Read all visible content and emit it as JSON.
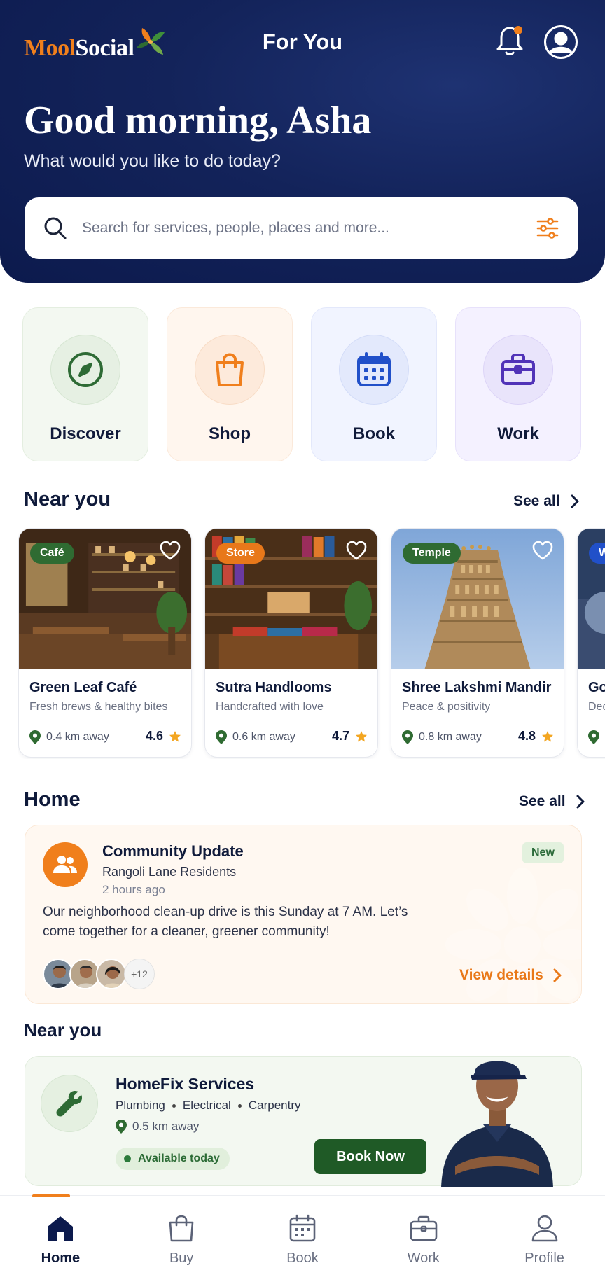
{
  "header": {
    "logo_part1": "Mool",
    "logo_part2": "Social",
    "title": "For You",
    "greeting": "Good morning, Asha",
    "subtitle": "What would you like to do today?"
  },
  "search": {
    "placeholder": "Search for services, people, places and more..."
  },
  "categories": [
    {
      "label": "Discover",
      "icon": "compass-icon",
      "color": "#2e6b35"
    },
    {
      "label": "Shop",
      "icon": "shopping-bag-icon",
      "color": "#f07f1c"
    },
    {
      "label": "Book",
      "icon": "calendar-icon",
      "color": "#2150c9"
    },
    {
      "label": "Work",
      "icon": "briefcase-icon",
      "color": "#5133b8"
    }
  ],
  "near_you": {
    "heading": "Near you",
    "see_all": "See all",
    "places": [
      {
        "badge": "Café",
        "badge_color": "#2f6b32",
        "name": "Green Leaf Café",
        "desc": "Fresh brews & healthy bites",
        "distance": "0.4 km away",
        "rating": "4.6"
      },
      {
        "badge": "Store",
        "badge_color": "#e8781a",
        "name": "Sutra Handlooms",
        "desc": "Handcrafted with love",
        "distance": "0.6 km away",
        "rating": "4.7"
      },
      {
        "badge": "Temple",
        "badge_color": "#2f6b32",
        "name": "Shree Lakshmi Mandir",
        "desc": "Peace & positivity",
        "distance": "0.8 km away",
        "rating": "4.8"
      },
      {
        "badge": "W",
        "badge_color": "#2150c9",
        "name": "Go",
        "desc": "Dec",
        "distance": "",
        "rating": ""
      }
    ]
  },
  "home": {
    "heading": "Home",
    "see_all": "See all",
    "update": {
      "title": "Community Update",
      "group": "Rangoli Lane Residents",
      "time": "2 hours ago",
      "badge": "New",
      "body": "Our neighborhood clean-up drive is this Sunday at 7 AM. Let’s come together for a cleaner, greener community!",
      "more_count": "+12",
      "action": "View details"
    }
  },
  "near_you_services": {
    "heading": "Near you",
    "service": {
      "name": "HomeFix Services",
      "tags": [
        "Plumbing",
        "Electrical",
        "Carpentry"
      ],
      "distance": "0.5 km away",
      "availability": "Available today",
      "action": "Book Now"
    }
  },
  "bottom_nav": [
    {
      "label": "Home",
      "icon": "home-icon",
      "active": true
    },
    {
      "label": "Buy",
      "icon": "shopping-bag-icon",
      "active": false
    },
    {
      "label": "Book",
      "icon": "calendar-icon",
      "active": false
    },
    {
      "label": "Work",
      "icon": "briefcase-icon",
      "active": false
    },
    {
      "label": "Profile",
      "icon": "user-icon",
      "active": false
    }
  ],
  "colors": {
    "navy": "#0c1a4d",
    "accent": "#f07f1c",
    "green": "#1f5a26"
  }
}
